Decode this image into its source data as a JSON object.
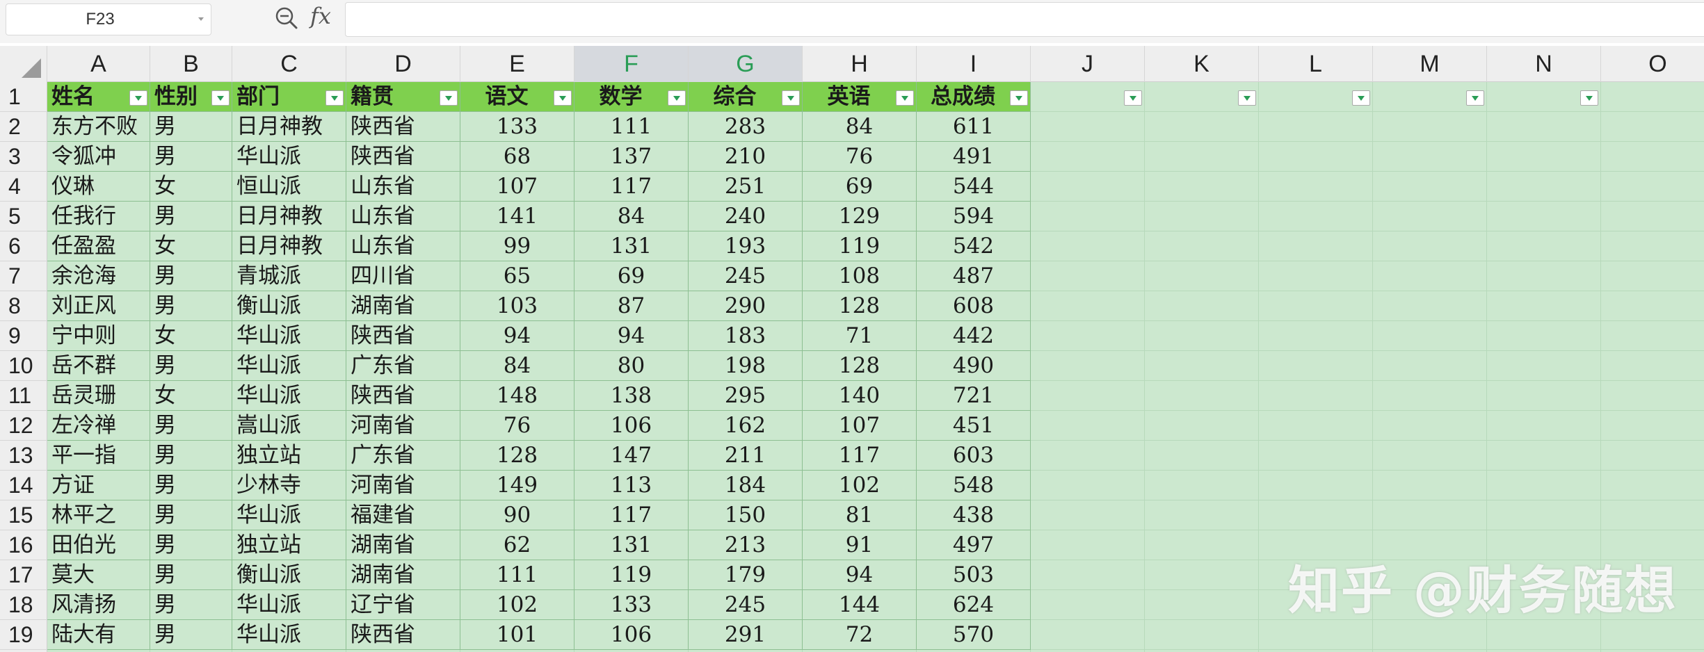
{
  "formula_bar": {
    "name_box": "F23",
    "zoom_icon": "zoom-out-icon",
    "fx_label": "fx",
    "formula": ""
  },
  "columns": [
    "A",
    "B",
    "C",
    "D",
    "E",
    "F",
    "G",
    "H",
    "I",
    "J",
    "K",
    "L",
    "M",
    "N",
    "O"
  ],
  "selected_columns": [
    "F",
    "G"
  ],
  "row_numbers": [
    "1",
    "2",
    "3",
    "4",
    "5",
    "6",
    "7",
    "8",
    "9",
    "10",
    "11",
    "12",
    "13",
    "14",
    "15",
    "16",
    "17",
    "18",
    "19"
  ],
  "sheet": {
    "headers": [
      "姓名",
      "性别",
      "部门",
      "籍贯",
      "语文",
      "数学",
      "综合",
      "英语",
      "总成绩"
    ],
    "rows": [
      [
        "东方不败",
        "男",
        "日月神教",
        "陕西省",
        "133",
        "111",
        "283",
        "84",
        "611"
      ],
      [
        "令狐冲",
        "男",
        "华山派",
        "陕西省",
        "68",
        "137",
        "210",
        "76",
        "491"
      ],
      [
        "仪琳",
        "女",
        "恒山派",
        "山东省",
        "107",
        "117",
        "251",
        "69",
        "544"
      ],
      [
        "任我行",
        "男",
        "日月神教",
        "山东省",
        "141",
        "84",
        "240",
        "129",
        "594"
      ],
      [
        "任盈盈",
        "女",
        "日月神教",
        "山东省",
        "99",
        "131",
        "193",
        "119",
        "542"
      ],
      [
        "余沧海",
        "男",
        "青城派",
        "四川省",
        "65",
        "69",
        "245",
        "108",
        "487"
      ],
      [
        "刘正风",
        "男",
        "衡山派",
        "湖南省",
        "103",
        "87",
        "290",
        "128",
        "608"
      ],
      [
        "宁中则",
        "女",
        "华山派",
        "陕西省",
        "94",
        "94",
        "183",
        "71",
        "442"
      ],
      [
        "岳不群",
        "男",
        "华山派",
        "广东省",
        "84",
        "80",
        "198",
        "128",
        "490"
      ],
      [
        "岳灵珊",
        "女",
        "华山派",
        "陕西省",
        "148",
        "138",
        "295",
        "140",
        "721"
      ],
      [
        "左冷禅",
        "男",
        "嵩山派",
        "河南省",
        "76",
        "106",
        "162",
        "107",
        "451"
      ],
      [
        "平一指",
        "男",
        "独立站",
        "广东省",
        "128",
        "147",
        "211",
        "117",
        "603"
      ],
      [
        "方证",
        "男",
        "少林寺",
        "河南省",
        "149",
        "113",
        "184",
        "102",
        "548"
      ],
      [
        "林平之",
        "男",
        "华山派",
        "福建省",
        "90",
        "117",
        "150",
        "81",
        "438"
      ],
      [
        "田伯光",
        "男",
        "独立站",
        "湖南省",
        "62",
        "131",
        "213",
        "91",
        "497"
      ],
      [
        "莫大",
        "男",
        "衡山派",
        "湖南省",
        "111",
        "119",
        "179",
        "94",
        "503"
      ],
      [
        "风清扬",
        "男",
        "华山派",
        "辽宁省",
        "102",
        "133",
        "245",
        "144",
        "624"
      ],
      [
        "陆大有",
        "男",
        "华山派",
        "陕西省",
        "101",
        "106",
        "291",
        "72",
        "570"
      ]
    ]
  },
  "colors": {
    "grid_background": "#cce8cf",
    "header_fill": "#7fd04e",
    "selected_column_text": "#2a9d56"
  },
  "watermark": "知乎 @财务随想"
}
